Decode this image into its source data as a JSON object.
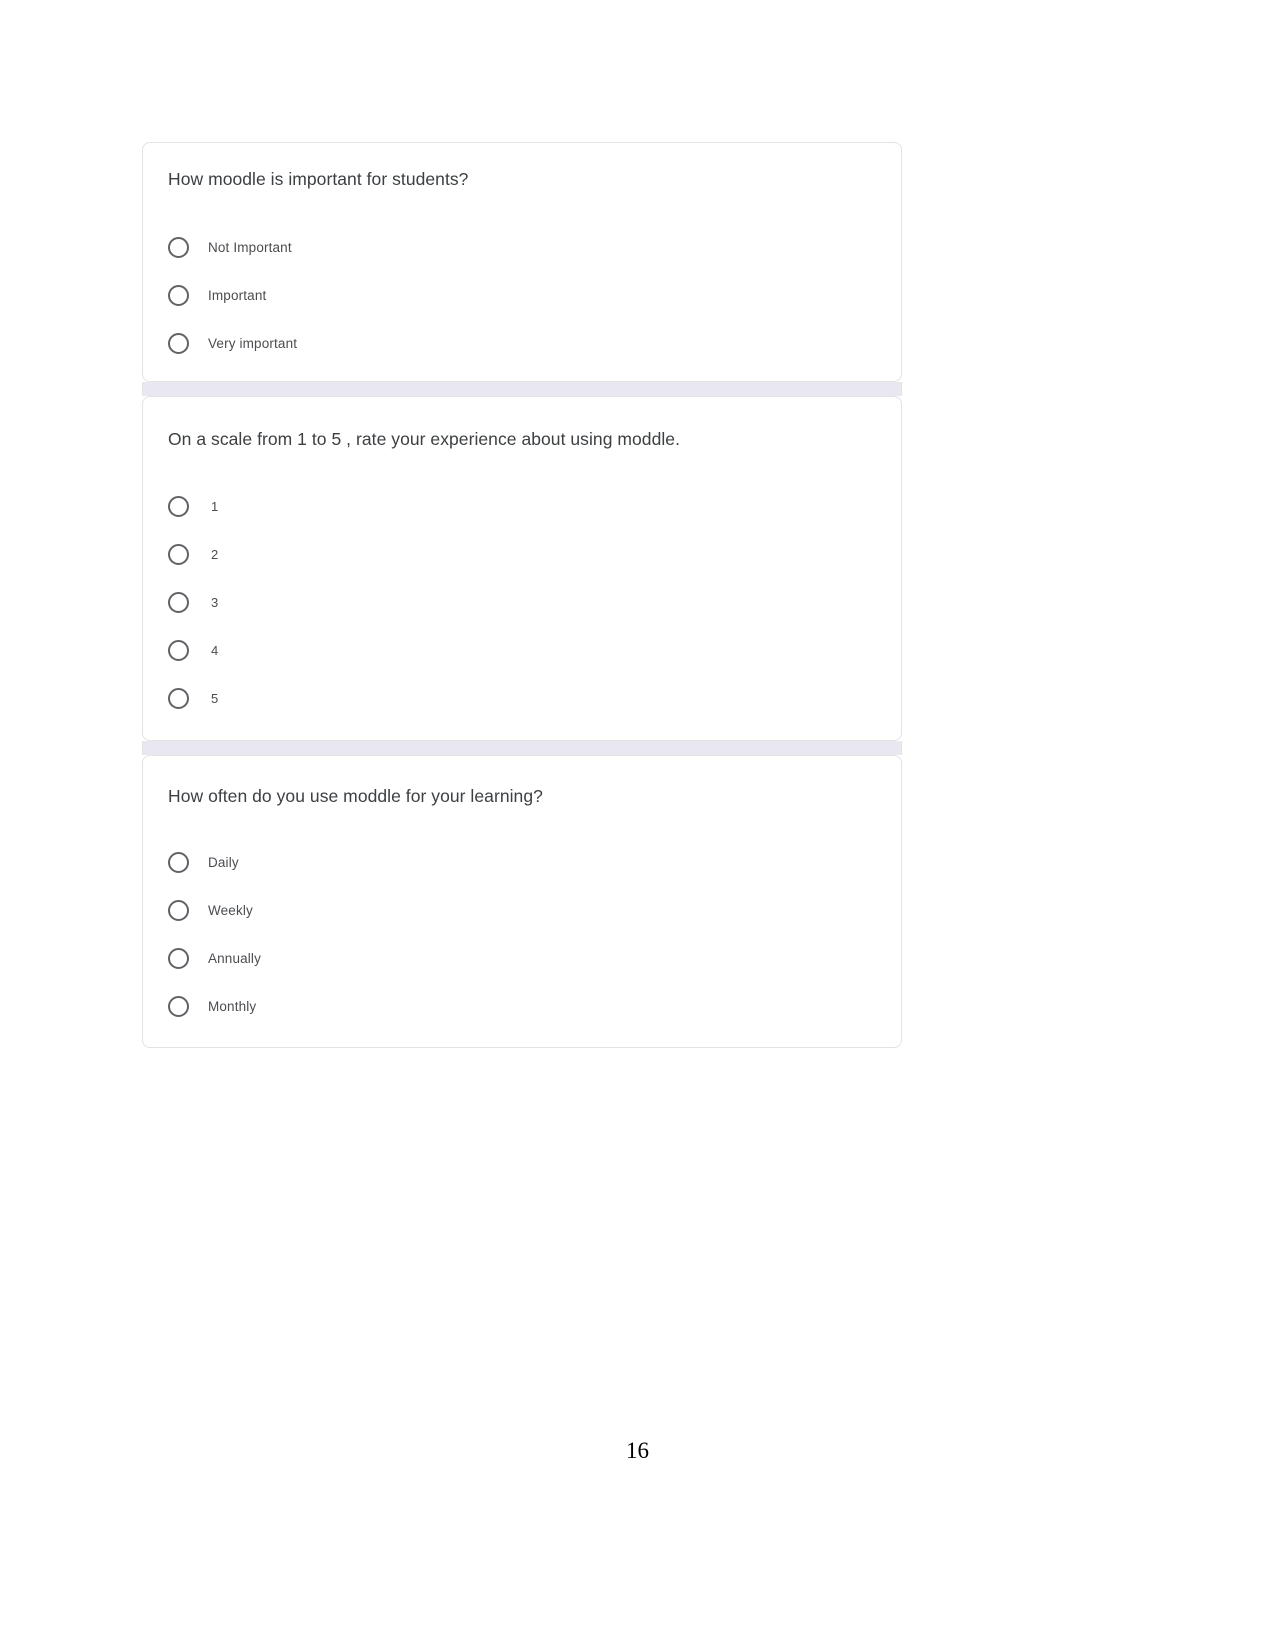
{
  "document": {
    "page_number": "16"
  },
  "form": {
    "questions": [
      {
        "title": "How moodle is important for students?",
        "options": [
          {
            "label": "Not Important"
          },
          {
            "label": "Important"
          },
          {
            "label": "Very important"
          }
        ]
      },
      {
        "title": "On a scale from 1 to 5 , rate your experience about using moddle.",
        "options": [
          {
            "label": "1"
          },
          {
            "label": "2"
          },
          {
            "label": "3"
          },
          {
            "label": "4"
          },
          {
            "label": "5"
          }
        ]
      },
      {
        "title": "How often do you use moddle for your learning?",
        "options": [
          {
            "label": "Daily"
          },
          {
            "label": "Weekly"
          },
          {
            "label": "Annually"
          },
          {
            "label": "Monthly"
          }
        ]
      }
    ]
  },
  "colors": {
    "card_border": "#e3e3e6",
    "separator": "#e9e8f1",
    "question_text": "#3c4043",
    "option_text": "#4a4d51",
    "radio_outline": "#5f6368"
  }
}
